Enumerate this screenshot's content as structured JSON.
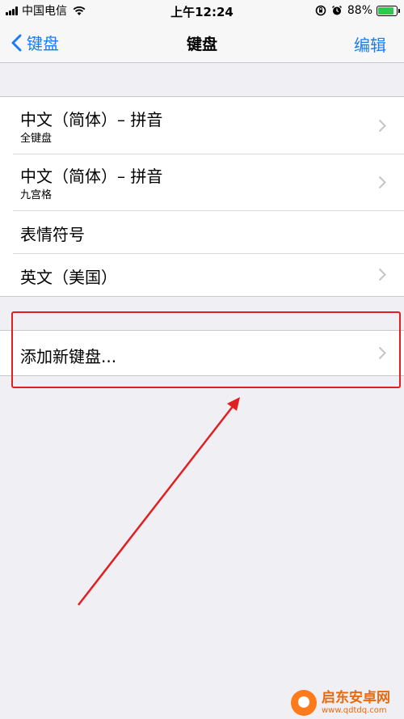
{
  "status_bar": {
    "carrier": "中国电信",
    "time": "上午12:24",
    "battery_percent": "88%",
    "battery_level": 0.88,
    "icons": [
      "signal-icon",
      "wifi-icon",
      "rotation-lock-icon",
      "alarm-icon",
      "battery-icon"
    ]
  },
  "nav": {
    "back_label": "键盘",
    "title": "键盘",
    "edit_label": "编辑"
  },
  "keyboards": [
    {
      "title": "中文（简体）– 拼音",
      "subtitle": "全键盘",
      "has_chevron": true
    },
    {
      "title": "中文（简体）– 拼音",
      "subtitle": "九宫格",
      "has_chevron": true
    },
    {
      "title": "表情符号",
      "subtitle": "",
      "has_chevron": false
    },
    {
      "title": "英文（美国）",
      "subtitle": "",
      "has_chevron": true
    }
  ],
  "add_keyboard": {
    "label": "添加新键盘..."
  },
  "annotation": {
    "color": "#e02020"
  },
  "watermark": {
    "name": "启东安卓网",
    "url": "www.qdtdq.com"
  },
  "colors": {
    "accent": "#1a7cf4",
    "background": "#efeff4",
    "battery": "#2dc84d"
  }
}
